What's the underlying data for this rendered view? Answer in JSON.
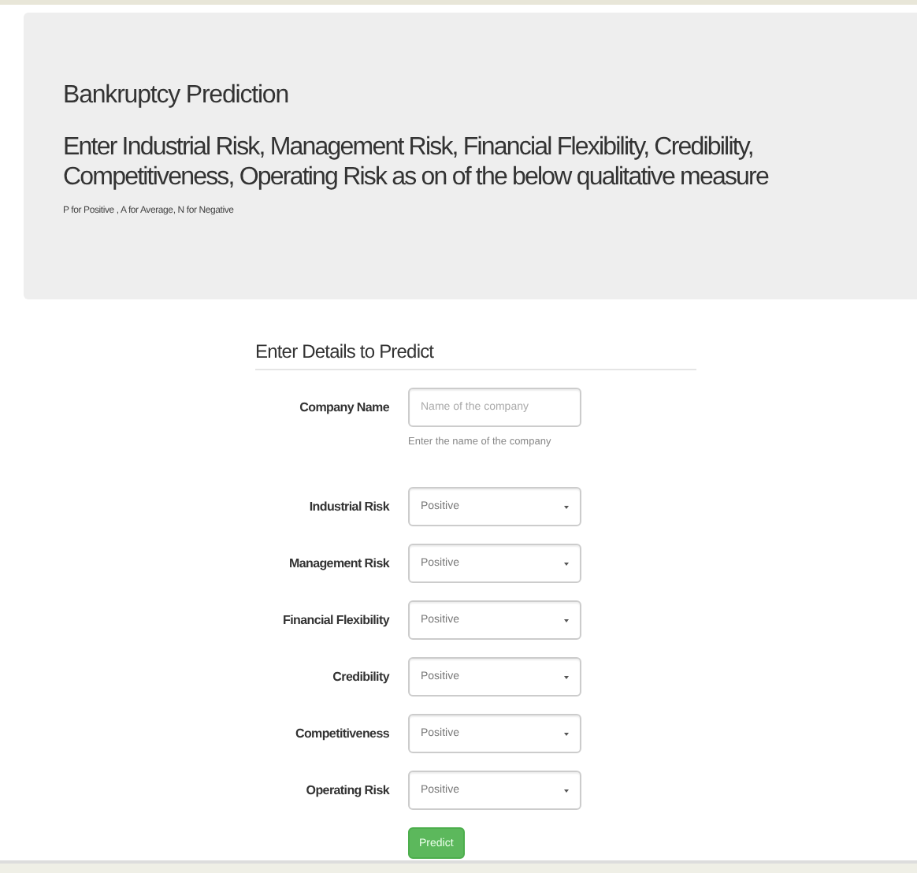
{
  "header": {
    "title": "Bankruptcy Prediction",
    "lead": "Enter Industrial Risk, Management Risk, Financial Flexibility, Credibility, Competitiveness, Operating Risk as on of the below qualitative measure",
    "note": "P for Positive , A for Average, N for Negative"
  },
  "form": {
    "legend": "Enter Details to Predict",
    "fields": [
      {
        "kind": "text",
        "label": "Company Name",
        "placeholder": "Name of the company",
        "help": "Enter the name of the company"
      },
      {
        "kind": "select",
        "label": "Industrial Risk",
        "value": "Positive"
      },
      {
        "kind": "select",
        "label": "Management Risk",
        "value": "Positive"
      },
      {
        "kind": "select",
        "label": "Financial Flexibility",
        "value": "Positive"
      },
      {
        "kind": "select",
        "label": "Credibility",
        "value": "Positive"
      },
      {
        "kind": "select",
        "label": "Competitiveness",
        "value": "Positive"
      },
      {
        "kind": "select",
        "label": "Operating Risk",
        "value": "Positive"
      }
    ],
    "submit": "Predict"
  }
}
